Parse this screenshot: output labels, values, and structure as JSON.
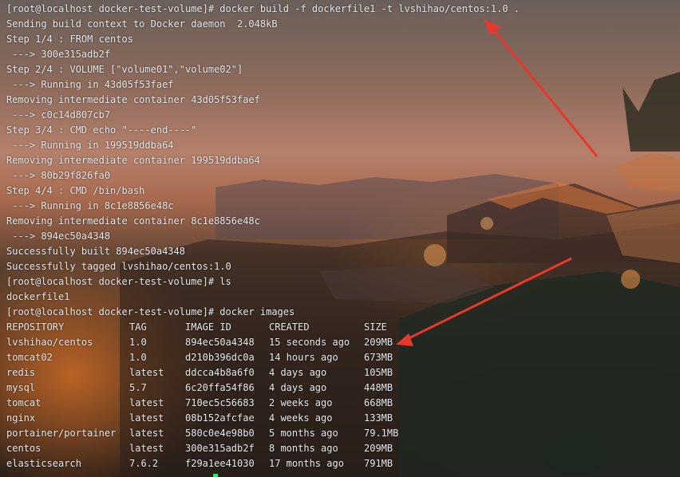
{
  "terminal": {
    "lines": [
      "[root@localhost docker-test-volume]# docker build -f dockerfile1 -t lvshihao/centos:1.0 .",
      "Sending build context to Docker daemon  2.048kB",
      "Step 1/4 : FROM centos",
      " ---> 300e315adb2f",
      "Step 2/4 : VOLUME [\"volume01\",\"volume02\"]",
      " ---> Running in 43d05f53faef",
      "Removing intermediate container 43d05f53faef",
      " ---> c0c14d807cb7",
      "Step 3/4 : CMD echo \"----end----\"",
      " ---> Running in 199519ddba64",
      "Removing intermediate container 199519ddba64",
      " ---> 80b29f826fa0",
      "Step 4/4 : CMD /bin/bash",
      " ---> Running in 8c1e8856e48c",
      "Removing intermediate container 8c1e8856e48c",
      " ---> 894ec50a4348",
      "Successfully built 894ec50a4348",
      "Successfully tagged lvshihao/centos:1.0",
      "[root@localhost docker-test-volume]# ls",
      "dockerfile1",
      "[root@localhost docker-test-volume]# docker images"
    ],
    "images_table": {
      "headers": [
        "REPOSITORY",
        "TAG",
        "IMAGE ID",
        "CREATED",
        "SIZE"
      ],
      "rows": [
        [
          "lvshihao/centos",
          "1.0",
          "894ec50a4348",
          "15 seconds ago",
          "209MB"
        ],
        [
          "tomcat02",
          "1.0",
          "d210b396dc0a",
          "14 hours ago",
          "673MB"
        ],
        [
          "redis",
          "latest",
          "ddcca4b8a6f0",
          "4 days ago",
          "105MB"
        ],
        [
          "mysql",
          "5.7",
          "6c20ffa54f86",
          "4 days ago",
          "448MB"
        ],
        [
          "tomcat",
          "latest",
          "710ec5c56683",
          "2 weeks ago",
          "668MB"
        ],
        [
          "nginx",
          "latest",
          "08b152afcfae",
          "4 weeks ago",
          "133MB"
        ],
        [
          "portainer/portainer",
          "latest",
          "580c0e4e98b0",
          "5 months ago",
          "79.1MB"
        ],
        [
          "centos",
          "latest",
          "300e315adb2f",
          "8 months ago",
          "209MB"
        ],
        [
          "elasticsearch",
          "7.6.2",
          "f29a1ee41030",
          "17 months ago",
          "791MB"
        ]
      ]
    },
    "cursor_color": "#2ee86a",
    "text_color": "#e8e8e8"
  },
  "annotations": {
    "arrow_color": "#e8382e"
  }
}
